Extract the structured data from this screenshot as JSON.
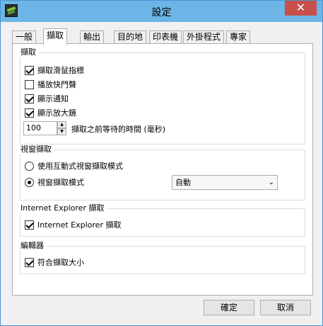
{
  "window": {
    "title": "設定",
    "close_glyph": "✕"
  },
  "tabs": [
    {
      "label": "一般",
      "active": false
    },
    {
      "label": "擷取",
      "active": true
    },
    {
      "label": "輸出",
      "active": false
    },
    {
      "label": "目的地",
      "active": false
    },
    {
      "label": "印表機",
      "active": false
    },
    {
      "label": "外掛程式",
      "active": false
    },
    {
      "label": "專家",
      "active": false
    }
  ],
  "capture_group": {
    "title": "擷取",
    "options": [
      {
        "label": "擷取滑鼠指標",
        "checked": true
      },
      {
        "label": "播放快門聲",
        "checked": false
      },
      {
        "label": "顯示通知",
        "checked": true
      },
      {
        "label": "顯示放大鏡",
        "checked": true
      }
    ],
    "delay_value": "100",
    "delay_label": "擷取之前等待的時間 (毫秒)"
  },
  "window_capture_group": {
    "title": "視窗擷取",
    "interactive_label": "使用互動式視窗擷取模式",
    "interactive_selected": false,
    "mode_label": "視窗擷取模式",
    "mode_selected": true,
    "mode_value": "自動"
  },
  "ie_group": {
    "title": "Internet Explorer 擷取",
    "option_label": "Internet Explorer 擷取",
    "checked": true
  },
  "editor_group": {
    "title": "編輯器",
    "option_label": "符合擷取大小",
    "checked": true
  },
  "footer": {
    "ok_label": "確定",
    "cancel_label": "取消"
  },
  "icons": {
    "app": "greenshot-icon",
    "close": "close-icon",
    "spin_up": "chevron-up-icon",
    "spin_down": "chevron-down-icon",
    "dropdown": "chevron-down-icon"
  },
  "colors": {
    "titlebar": "#6cb5e6",
    "close_button": "#c7504a",
    "panel": "#ffffff",
    "dialog": "#f0f0f0"
  }
}
